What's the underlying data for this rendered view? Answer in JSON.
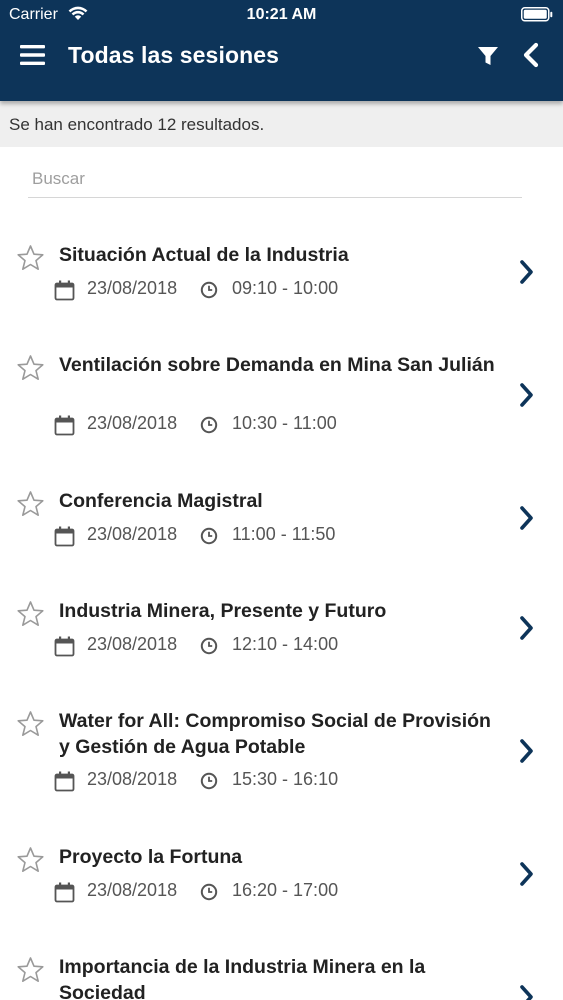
{
  "status": {
    "carrier": "Carrier",
    "time": "10:21 AM"
  },
  "nav": {
    "title": "Todas las sesiones"
  },
  "results_text": "Se han encontrado 12 resultados.",
  "search": {
    "placeholder": "Buscar",
    "value": ""
  },
  "colors": {
    "header": "#0d3459",
    "accent": "#0d3459"
  },
  "sessions": [
    {
      "title": "Situación Actual de la Industria",
      "date": "23/08/2018",
      "time": "09:10 - 10:00"
    },
    {
      "title": "Ventilación sobre Demanda en Mina San Julián",
      "date": "23/08/2018",
      "time": "10:30 - 11:00"
    },
    {
      "title": "Conferencia Magistral",
      "date": "23/08/2018",
      "time": "11:00 - 11:50"
    },
    {
      "title": "Industria Minera, Presente y Futuro",
      "date": "23/08/2018",
      "time": "12:10 - 14:00"
    },
    {
      "title": "Water for All: Compromiso Social de Provisión y Gestión de Agua Potable",
      "date": "23/08/2018",
      "time": "15:30 - 16:10"
    },
    {
      "title": "Proyecto la Fortuna",
      "date": "23/08/2018",
      "time": "16:20 - 17:00"
    },
    {
      "title": "Importancia de la Industria Minera en la Sociedad",
      "date": "",
      "time": ""
    }
  ]
}
